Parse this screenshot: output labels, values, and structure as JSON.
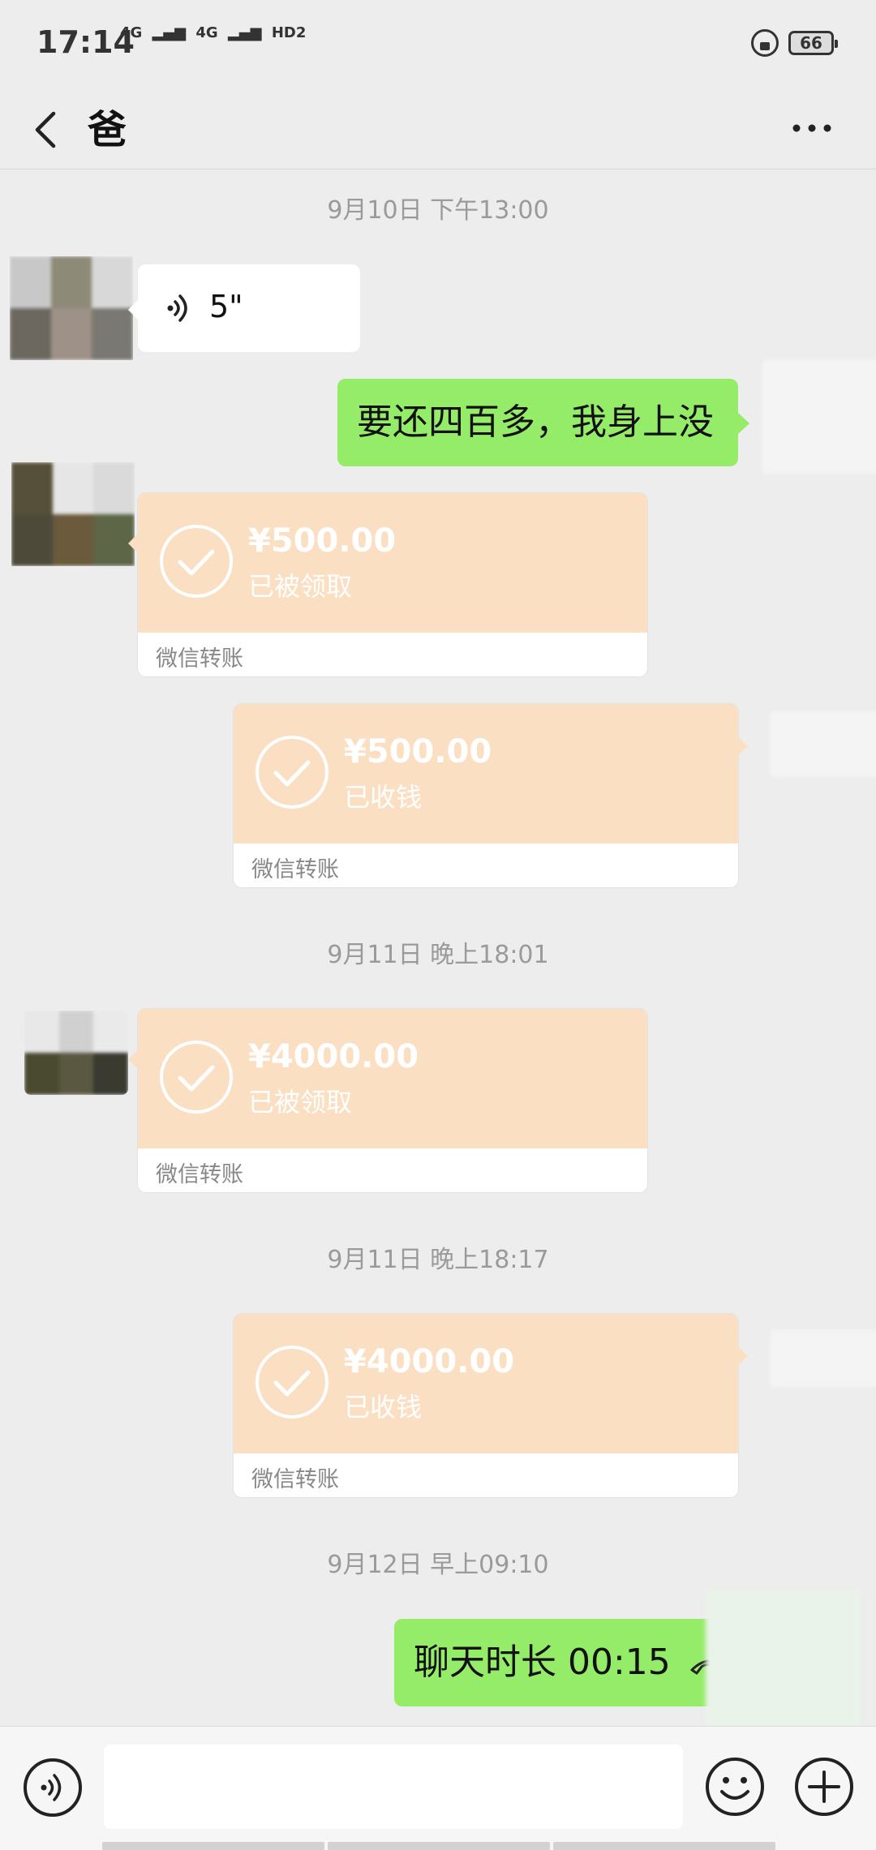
{
  "status_bar": {
    "time": "17:14",
    "signal_1": "4G",
    "signal_2": "4G",
    "hd": "HD2",
    "battery": "66"
  },
  "header": {
    "title": "爸"
  },
  "messages": [
    {
      "type": "timestamp",
      "text": "9月10日 下午13:00"
    },
    {
      "type": "voice",
      "side": "left",
      "duration": "5\""
    },
    {
      "type": "text",
      "side": "right",
      "text": "要还四百多，我身上没"
    },
    {
      "type": "transfer",
      "side": "left",
      "amount": "¥500.00",
      "status": "已被领取",
      "label": "微信转账"
    },
    {
      "type": "transfer",
      "side": "right",
      "amount": "¥500.00",
      "status": "已收钱",
      "label": "微信转账"
    },
    {
      "type": "timestamp",
      "text": "9月11日 晚上18:01"
    },
    {
      "type": "transfer",
      "side": "left",
      "amount": "¥4000.00",
      "status": "已被领取",
      "label": "微信转账"
    },
    {
      "type": "timestamp",
      "text": "9月11日 晚上18:17"
    },
    {
      "type": "transfer",
      "side": "right",
      "amount": "¥4000.00",
      "status": "已收钱",
      "label": "微信转账"
    },
    {
      "type": "timestamp",
      "text": "9月12日 早上09:10"
    },
    {
      "type": "call",
      "side": "right",
      "text": "聊天时长 00:15"
    }
  ],
  "input": {
    "value": "",
    "placeholder": ""
  },
  "colors": {
    "background": "#ededed",
    "green_bubble": "#95ec69",
    "transfer_bubble": "#fbdfc3"
  },
  "icons": [
    "back-arrow-icon",
    "more-icon",
    "voice-icon",
    "check-icon",
    "call-end-icon",
    "voice-input-icon",
    "emoji-icon",
    "plus-icon"
  ]
}
